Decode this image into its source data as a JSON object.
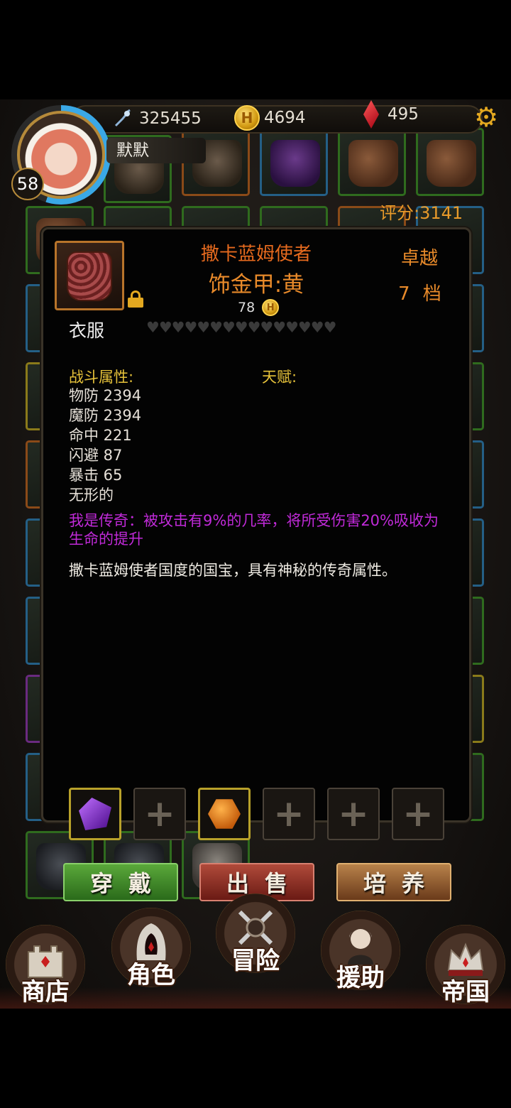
{
  "player": {
    "level": "58",
    "name": "默默",
    "power": "325455",
    "gold": "4694",
    "gems": "495",
    "score": "评分:3141"
  },
  "item": {
    "title": "撒卡蓝姆使者",
    "subtitle": "饰金甲:黄",
    "price": "78",
    "tier": "卓越",
    "grade": "7 档",
    "category": "衣服",
    "hearts": "♥♥♥♥♥♥♥♥♥♥♥♥♥♥♥",
    "combat_label": "战斗属性:",
    "talent_label": "天赋:",
    "stats": [
      "物防 2394",
      "魔防 2394",
      "命中 221",
      "闪避 87",
      "暴击 65",
      "无形的"
    ],
    "legend_text": "我是传奇：被攻击有9%的几率，将所受伤害20%吸收为生命的提升",
    "description": "撒卡蓝姆使者国度的国宝，具有神秘的传奇属性。"
  },
  "sockets": [
    {
      "state": "filled",
      "gem": "purple"
    },
    {
      "state": "empty",
      "label": "+"
    },
    {
      "state": "filled",
      "gem": "orange"
    },
    {
      "state": "empty",
      "label": "+"
    },
    {
      "state": "empty",
      "label": "+"
    },
    {
      "state": "empty",
      "label": "+"
    }
  ],
  "actions": {
    "wear": "穿戴",
    "sell": "出售",
    "train": "培养"
  },
  "nav": {
    "shop": "商店",
    "role": "角色",
    "adventure": "冒险",
    "assist": "援助",
    "empire": "帝国"
  },
  "colors": {
    "title_orange": "#e66a1e",
    "stat_gold": "#e6c23a",
    "legend_purple": "#c02ad8",
    "score_orange": "#e89a2a"
  },
  "icons": [
    "power-icon",
    "gold-coin-icon",
    "red-gem-icon",
    "settings-gear-icon",
    "lock-icon"
  ]
}
